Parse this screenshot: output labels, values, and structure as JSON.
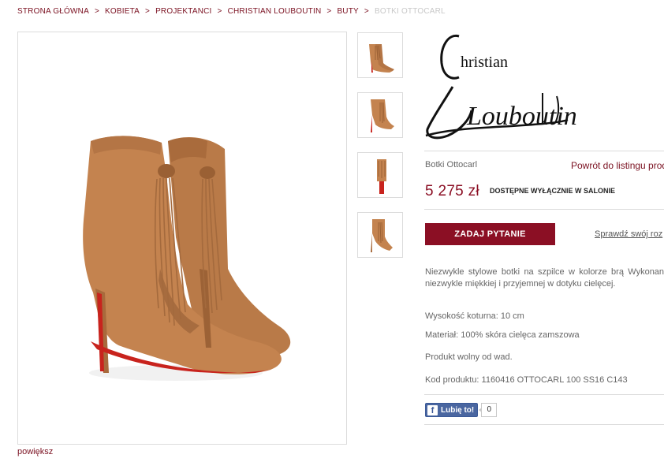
{
  "breadcrumb": {
    "items": [
      "STRONA GŁÓWNA",
      "KOBIETA",
      "PROJEKTANCI",
      "CHRISTIAN LOUBOUTIN",
      "BUTY"
    ],
    "current": "BOTKI OTTOCARL",
    "separator": ">"
  },
  "gallery": {
    "zoom_label": "powiększ"
  },
  "brand": {
    "logo_text_first": "hristian",
    "logo_text_second": "Louboutin"
  },
  "product": {
    "name": "Botki Ottocarl",
    "back_label": "Powrót do listingu prod",
    "price": "5 275 zł",
    "availability": "DOSTĘPNE WYŁĄCZNIE W SALONIE",
    "ask_button": "ZADAJ PYTANIE",
    "size_link": "Sprawdź swój roz",
    "description": "Niezwykle stylowe botki na szpilce w kolorze brą Wykonane z niezwykle miękkiej i przyjemnej w dotyku cielęcej.",
    "heel_height": "Wysokość koturna: 10 cm",
    "material": "Materiał: 100% skóra cielęca zamszowa",
    "defects": "Produkt wolny od wad.",
    "product_code": "Kod produktu: 1160416 OTTOCARL 100 SS16 C143"
  },
  "social": {
    "like_label": "Lubię to!",
    "like_count": "0",
    "fb_icon": "f"
  },
  "colors": {
    "accent": "#8b0f24",
    "link": "#7a1020",
    "suede": "#c4834f",
    "sole_red": "#c8231d"
  }
}
